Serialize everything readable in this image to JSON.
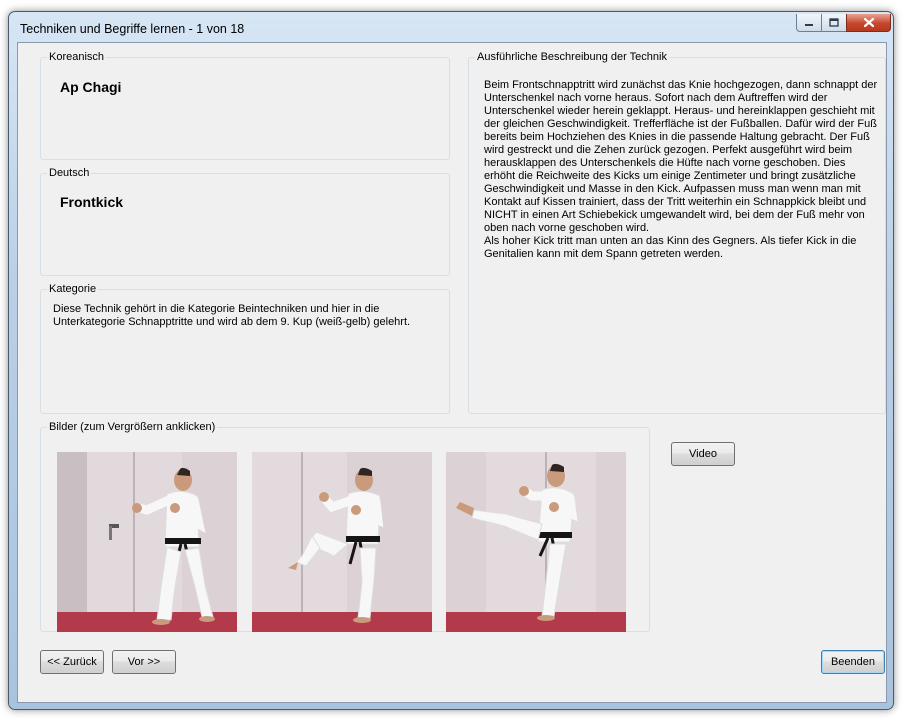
{
  "window": {
    "title": "Techniken und Begriffe lernen - 1 von 18"
  },
  "korean": {
    "legend": "Koreanisch",
    "value": "Ap Chagi"
  },
  "german": {
    "legend": "Deutsch",
    "value": "Frontkick"
  },
  "category": {
    "legend": "Kategorie",
    "text": "Diese Technik gehört in die Kategorie Beintechniken und hier in die\nUnterkategorie Schnapptritte und wird ab dem 9. Kup (weiß-gelb) gelehrt."
  },
  "description": {
    "legend": "Ausführliche Beschreibung der Technik",
    "text": "Beim Frontschnapptritt wird zunächst das Knie hochgezogen, dann schnappt der\nUnterschenkel nach vorne heraus. Sofort nach dem Auftreffen wird der\nUnterschenkel wieder herein geklappt. Heraus- und hereinklappen geschieht mit\nder gleichen Geschwindigkeit. Trefferfläche ist der Fußballen. Dafür wird der Fuß\nbereits beim Hochziehen des Knies in die passende Haltung gebracht. Der Fuß\nwird gestreckt und die Zehen zurück gezogen. Perfekt ausgeführt wird beim\nherausklappen des Unterschenkels die Hüfte nach vorne geschoben. Dies\nerhöht die Reichweite des Kicks um einige Zentimeter und bringt zusätzliche\nGeschwindigkeit und Masse in den Kick. Aufpassen muss man wenn man mit\nKontakt auf Kissen trainiert, dass der Tritt weiterhin ein Schnappkick bleibt und\nNICHT in einen Art Schiebekick umgewandelt wird, bei dem der Fuß mehr von\noben nach vorne geschoben wird.\nAls hoher Kick tritt man unten an das Kinn des Gegners. Als tiefer Kick in die\nGenitalien kann mit dem Spann getreten werden."
  },
  "images": {
    "legend": "Bilder (zum Vergrößern anklicken)"
  },
  "buttons": {
    "video": "Video",
    "back": "<< Zurück",
    "forward": "Vor >>",
    "quit": "Beenden"
  },
  "colors": {
    "wall": "#d9cfd2",
    "floor": "#b33a4a",
    "belt": "#151515",
    "gi": "#f7f7f7",
    "skin": "#c99a7c"
  },
  "icons": [
    "minimize-icon",
    "maximize-icon",
    "close-icon"
  ]
}
